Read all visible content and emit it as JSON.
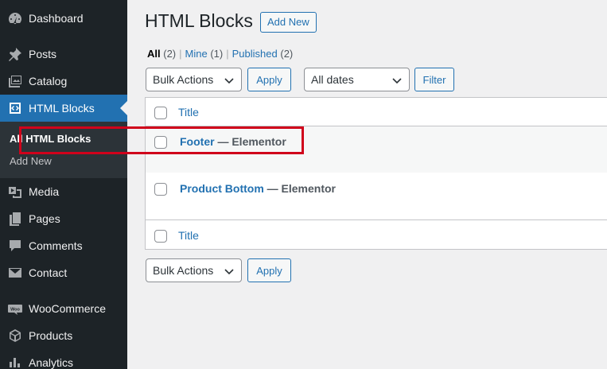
{
  "sidebar": {
    "items": [
      {
        "label": "Dashboard",
        "icon": "dashboard-icon"
      },
      {
        "label": "Posts",
        "icon": "pin-icon"
      },
      {
        "label": "Catalog",
        "icon": "gallery-icon"
      },
      {
        "label": "HTML Blocks",
        "icon": "code-block-icon"
      },
      {
        "label": "Media",
        "icon": "media-icon"
      },
      {
        "label": "Pages",
        "icon": "pages-icon"
      },
      {
        "label": "Comments",
        "icon": "comment-icon"
      },
      {
        "label": "Contact",
        "icon": "mail-icon"
      },
      {
        "label": "WooCommerce",
        "icon": "woocommerce-icon"
      },
      {
        "label": "Products",
        "icon": "box-icon"
      },
      {
        "label": "Analytics",
        "icon": "bar-chart-icon"
      }
    ],
    "submenu": [
      {
        "label": "All HTML Blocks"
      },
      {
        "label": "Add New"
      }
    ]
  },
  "header": {
    "title": "HTML Blocks",
    "add_new_label": "Add New"
  },
  "filters": {
    "all_label": "All",
    "all_count": "(2)",
    "mine_label": "Mine",
    "mine_count": "(1)",
    "published_label": "Published",
    "published_count": "(2)",
    "separator": "|"
  },
  "toolbar": {
    "bulk_actions": "Bulk Actions",
    "apply": "Apply",
    "dates": "All dates",
    "filter": "Filter"
  },
  "table": {
    "column_title": "Title",
    "rows": [
      {
        "title": "Footer",
        "state": " — Elementor"
      },
      {
        "title": "Product Bottom",
        "state": " — Elementor"
      }
    ]
  },
  "colors": {
    "sidebar_bg": "#1d2327",
    "accent": "#2271b1",
    "highlight": "#d0021b"
  }
}
